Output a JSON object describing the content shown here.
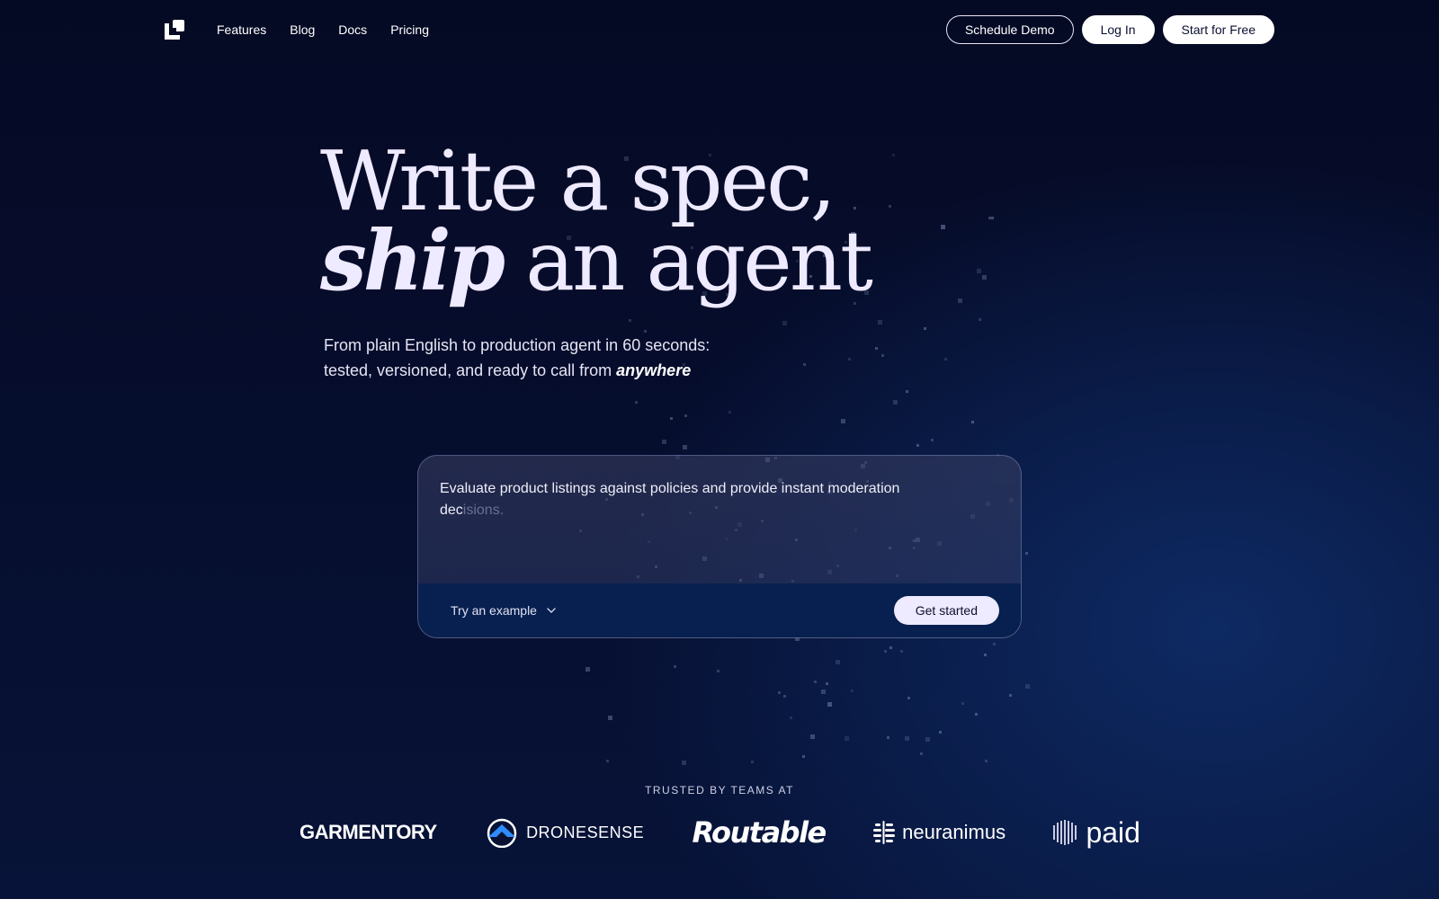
{
  "nav": {
    "logo_icon": "logo-icon",
    "links": [
      "Features",
      "Blog",
      "Docs",
      "Pricing"
    ],
    "schedule_demo": "Schedule Demo",
    "log_in": "Log In",
    "start_free": "Start for Free"
  },
  "hero": {
    "title_line1": "Write a spec,",
    "title_emph": "ship",
    "title_line2_rest": " an agent",
    "sub_line1": "From plain English to production agent in 60 seconds:",
    "sub_line2_prefix": "tested, versioned, and ready to call from ",
    "sub_emph": "anywhere"
  },
  "prompt_card": {
    "text_visible": "Evaluate product listings against policies and provide instant moderation dec",
    "text_faded": "isions.",
    "example_label": "Try an example",
    "example_icon": "chevron-down-icon",
    "cta_label": "Get started"
  },
  "trusted": {
    "heading": "TRUSTED BY TEAMS AT",
    "brands": [
      "GARMENTORY",
      "DRONESENSE",
      "Routable",
      "neuranimus",
      "paid"
    ]
  },
  "colors": {
    "background": "#050a24",
    "accent_glow": "#0e2a63",
    "text": "#eeeaff",
    "card_bar": "#08204f"
  }
}
